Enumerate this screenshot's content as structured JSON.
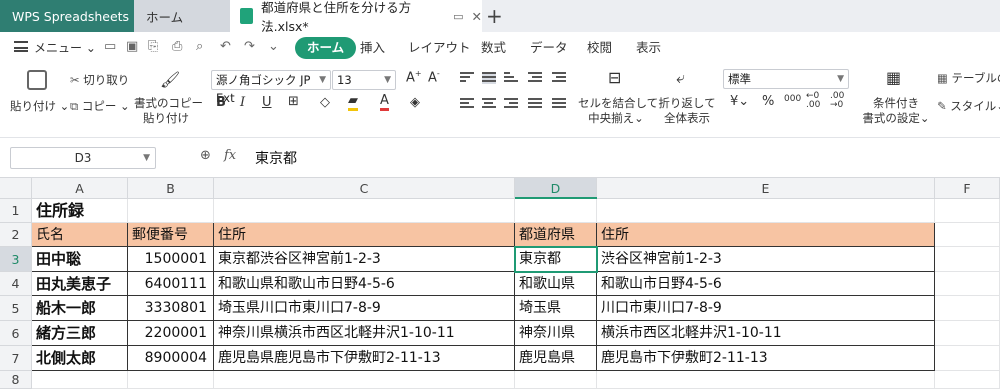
{
  "tabs": {
    "app": "WPS Spreadsheets",
    "home": "ホーム",
    "document": "都道府県と住所を分ける方法.xlsx*"
  },
  "menu": {
    "menu_label": "メニュー",
    "tabs": [
      "ホーム",
      "挿入",
      "レイアウト",
      "数式",
      "データ",
      "校閲",
      "表示"
    ],
    "active_tab": "ホーム"
  },
  "ribbon": {
    "paste": "貼り付け",
    "cut": "切り取り",
    "copy": "コピー",
    "format_painter_line1": "書式のコピー",
    "format_painter_line2": "貼り付け",
    "font_name": "源ノ角ゴシック JP Ext",
    "font_size": "13",
    "merge_line1": "セルを結合して",
    "merge_line2": "中央揃え",
    "wrap_line1": "折り返して",
    "wrap_line2": "全体表示",
    "number_format": "標準",
    "currency": "¥",
    "percent": "%",
    "cond_line1": "条件付き",
    "cond_line2": "書式の設定",
    "table": "テーブルの",
    "style": "スタイル"
  },
  "formula_bar": {
    "name_box": "D3",
    "fx": "fx",
    "value": "東京都"
  },
  "sheet": {
    "columns": [
      "A",
      "B",
      "C",
      "D",
      "E",
      "F"
    ],
    "active_column": "D",
    "active_row": "3",
    "rows": [
      "1",
      "2",
      "3",
      "4",
      "5",
      "6",
      "7",
      "8"
    ],
    "title": "住所録",
    "headers": [
      "氏名",
      "郵便番号",
      "住所",
      "都道府県",
      "住所"
    ],
    "records": [
      [
        "田中聡",
        "1500001",
        "東京都渋谷区神宮前1-2-3",
        "東京都",
        "渋谷区神宮前1-2-3"
      ],
      [
        "田丸美恵子",
        "6400111",
        "和歌山県和歌山市日野4-5-6",
        "和歌山県",
        "和歌山市日野4-5-6"
      ],
      [
        "船木一郎",
        "3330801",
        "埼玉県川口市東川口7-8-9",
        "埼玉県",
        "川口市東川口7-8-9"
      ],
      [
        "緒方三郎",
        "2200001",
        "神奈川県横浜市西区北軽井沢1-10-11",
        "神奈川県",
        "横浜市西区北軽井沢1-10-11"
      ],
      [
        "北側太郎",
        "8900004",
        "鹿児島県鹿児島市下伊敷町2-11-13",
        "鹿児島県",
        "鹿児島市下伊敷町2-11-13"
      ]
    ]
  },
  "colors": {
    "accent": "#1f9a74",
    "header_fill": "#f7c4a3",
    "app_tab": "#2f7e72"
  }
}
